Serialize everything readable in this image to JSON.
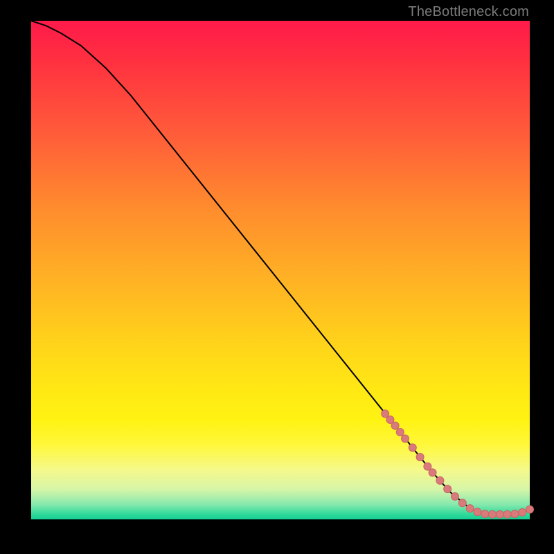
{
  "attribution": "TheBottleneck.com",
  "colors": {
    "curve": "#000000",
    "marker_fill": "#d97a7b",
    "marker_stroke": "#c96465",
    "background_black": "#000000"
  },
  "chart_data": {
    "type": "line",
    "title": "",
    "xlabel": "",
    "ylabel": "",
    "xlim": [
      0,
      100
    ],
    "ylim": [
      0,
      100
    ],
    "grid": false,
    "series": [
      {
        "name": "bottleneck-curve",
        "x": [
          0,
          3,
          6,
          10,
          15,
          20,
          30,
          40,
          50,
          60,
          70,
          76,
          80,
          84,
          88,
          90,
          92,
          94,
          96,
          98,
          100
        ],
        "y": [
          100,
          99,
          97.5,
          95,
          90.5,
          85,
          72.5,
          60,
          47.5,
          35,
          22.5,
          15,
          10,
          5.5,
          2.2,
          1.4,
          1.0,
          1.0,
          1.0,
          1.2,
          2.0
        ]
      }
    ],
    "markers": [
      {
        "x": 71,
        "y": 21.2
      },
      {
        "x": 72,
        "y": 20.0
      },
      {
        "x": 73,
        "y": 18.8
      },
      {
        "x": 74,
        "y": 17.5
      },
      {
        "x": 75,
        "y": 16.2
      },
      {
        "x": 76.5,
        "y": 14.4
      },
      {
        "x": 78,
        "y": 12.5
      },
      {
        "x": 79.5,
        "y": 10.6
      },
      {
        "x": 80.5,
        "y": 9.4
      },
      {
        "x": 82,
        "y": 7.8
      },
      {
        "x": 83.5,
        "y": 6.1
      },
      {
        "x": 85,
        "y": 4.6
      },
      {
        "x": 86.5,
        "y": 3.3
      },
      {
        "x": 88,
        "y": 2.2
      },
      {
        "x": 89.5,
        "y": 1.5
      },
      {
        "x": 91,
        "y": 1.1
      },
      {
        "x": 92.5,
        "y": 1.0
      },
      {
        "x": 94,
        "y": 1.0
      },
      {
        "x": 95.5,
        "y": 1.0
      },
      {
        "x": 97,
        "y": 1.1
      },
      {
        "x": 98.5,
        "y": 1.4
      },
      {
        "x": 100,
        "y": 2.0
      }
    ]
  }
}
